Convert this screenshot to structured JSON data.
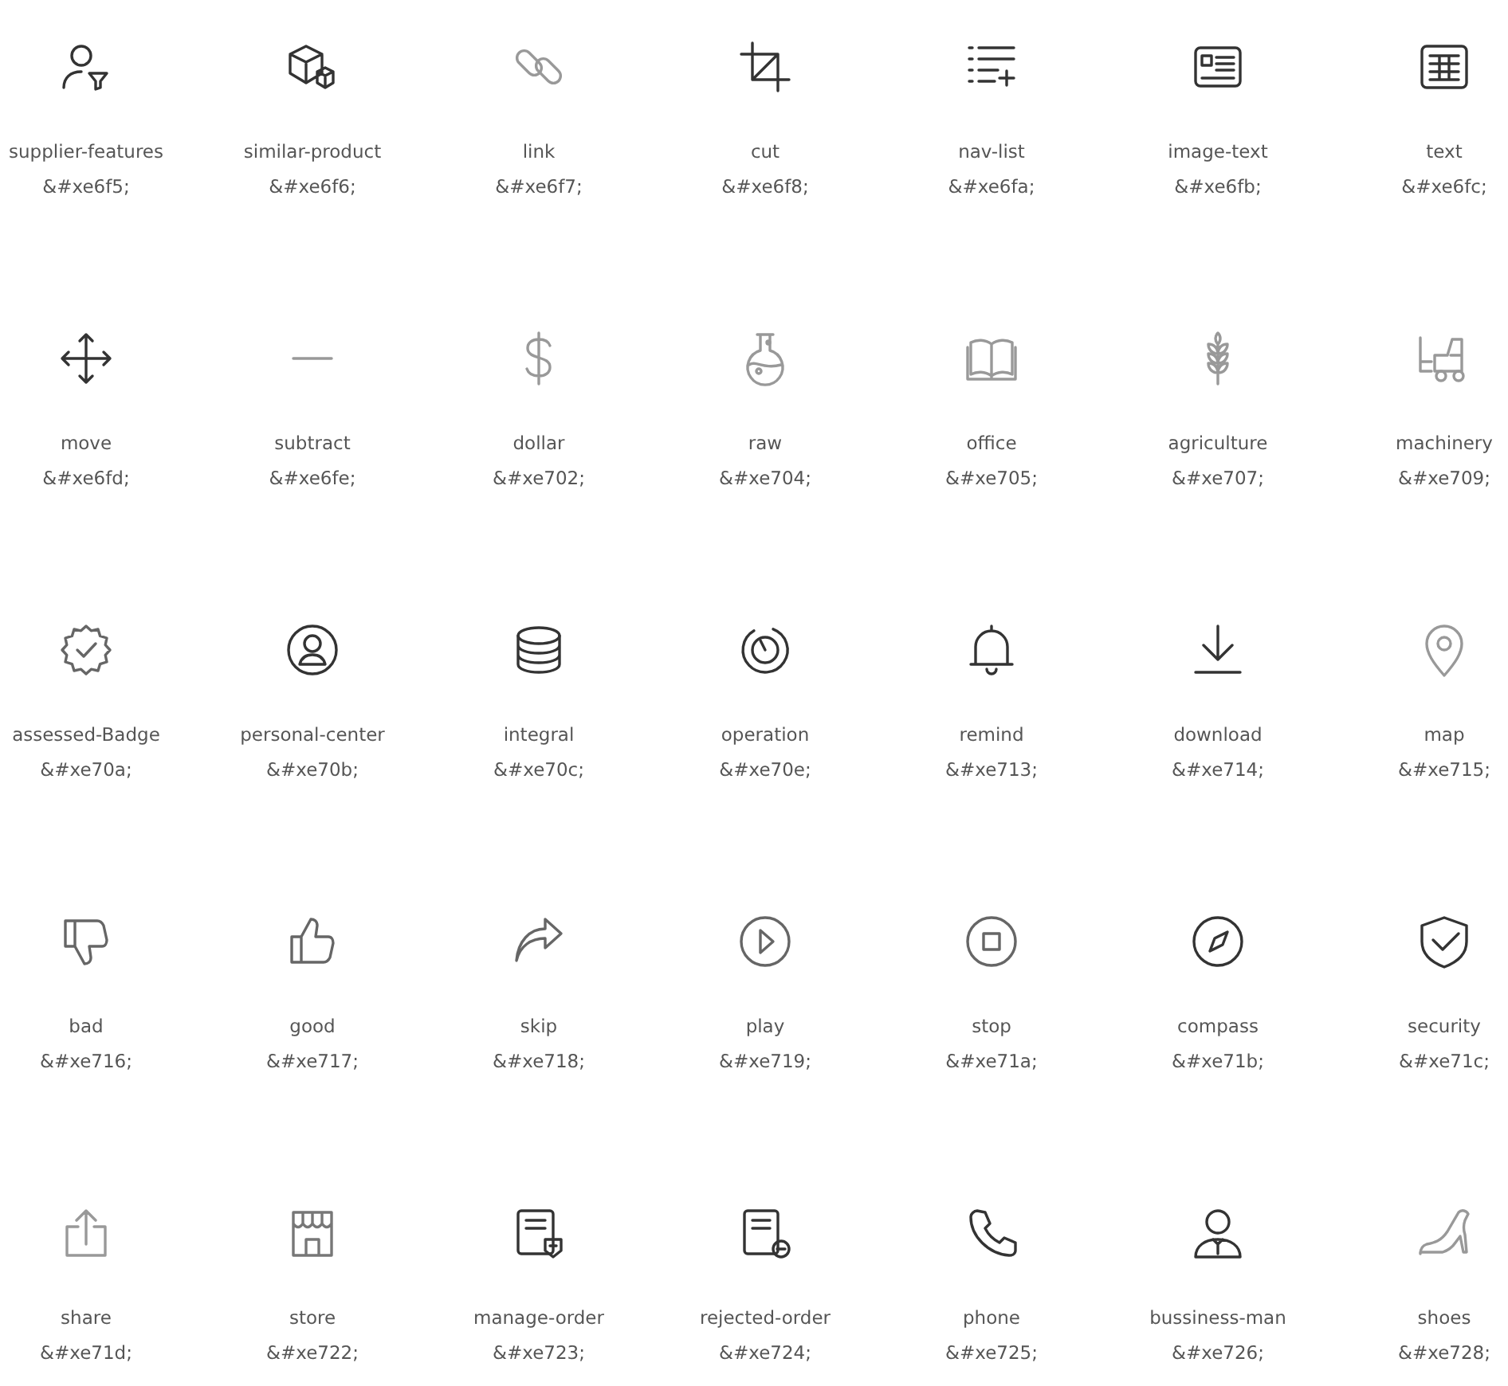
{
  "icons": [
    {
      "name": "supplier-features",
      "code": "&#xe6f5;",
      "color": "#333333"
    },
    {
      "name": "similar-product",
      "code": "&#xe6f6;",
      "color": "#333333"
    },
    {
      "name": "link",
      "code": "&#xe6f7;",
      "color": "#999999"
    },
    {
      "name": "cut",
      "code": "&#xe6f8;",
      "color": "#333333"
    },
    {
      "name": "nav-list",
      "code": "&#xe6fa;",
      "color": "#333333"
    },
    {
      "name": "image-text",
      "code": "&#xe6fb;",
      "color": "#333333"
    },
    {
      "name": "text",
      "code": "&#xe6fc;",
      "color": "#333333"
    },
    {
      "name": "move",
      "code": "&#xe6fd;",
      "color": "#333333"
    },
    {
      "name": "subtract",
      "code": "&#xe6fe;",
      "color": "#999999"
    },
    {
      "name": "dollar",
      "code": "&#xe702;",
      "color": "#999999"
    },
    {
      "name": "raw",
      "code": "&#xe704;",
      "color": "#999999"
    },
    {
      "name": "office",
      "code": "&#xe705;",
      "color": "#999999"
    },
    {
      "name": "agriculture",
      "code": "&#xe707;",
      "color": "#999999"
    },
    {
      "name": "machinery",
      "code": "&#xe709;",
      "color": "#999999"
    },
    {
      "name": "assessed-Badge",
      "code": "&#xe70a;",
      "color": "#666666"
    },
    {
      "name": "personal-center",
      "code": "&#xe70b;",
      "color": "#333333"
    },
    {
      "name": "integral",
      "code": "&#xe70c;",
      "color": "#333333"
    },
    {
      "name": "operation",
      "code": "&#xe70e;",
      "color": "#333333"
    },
    {
      "name": "remind",
      "code": "&#xe713;",
      "color": "#333333"
    },
    {
      "name": "download",
      "code": "&#xe714;",
      "color": "#333333"
    },
    {
      "name": "map",
      "code": "&#xe715;",
      "color": "#999999"
    },
    {
      "name": "bad",
      "code": "&#xe716;",
      "color": "#666666"
    },
    {
      "name": "good",
      "code": "&#xe717;",
      "color": "#666666"
    },
    {
      "name": "skip",
      "code": "&#xe718;",
      "color": "#666666"
    },
    {
      "name": "play",
      "code": "&#xe719;",
      "color": "#666666"
    },
    {
      "name": "stop",
      "code": "&#xe71a;",
      "color": "#666666"
    },
    {
      "name": "compass",
      "code": "&#xe71b;",
      "color": "#333333"
    },
    {
      "name": "security",
      "code": "&#xe71c;",
      "color": "#333333"
    },
    {
      "name": "share",
      "code": "&#xe71d;",
      "color": "#999999"
    },
    {
      "name": "store",
      "code": "&#xe722;",
      "color": "#777777"
    },
    {
      "name": "manage-order",
      "code": "&#xe723;",
      "color": "#333333"
    },
    {
      "name": "rejected-order",
      "code": "&#xe724;",
      "color": "#333333"
    },
    {
      "name": "phone",
      "code": "&#xe725;",
      "color": "#333333"
    },
    {
      "name": "bussiness-man",
      "code": "&#xe726;",
      "color": "#333333"
    },
    {
      "name": "shoes",
      "code": "&#xe728;",
      "color": "#999999"
    }
  ]
}
